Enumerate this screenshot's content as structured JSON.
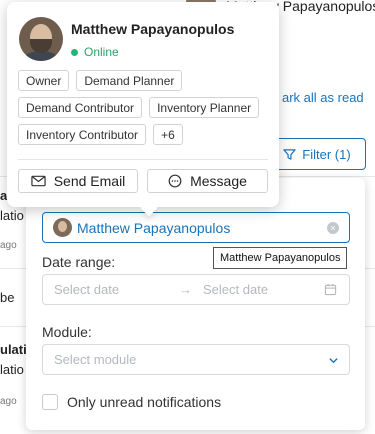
{
  "background": {
    "header_user_name": "Matthew Papayanopulos",
    "mark_all_read": "ark all as read",
    "filter_button": "Filter (1)",
    "rows": [
      {
        "a": "al",
        "b": "latio",
        "c": "ago"
      },
      {
        "a": "be"
      },
      {
        "a": "ulatio",
        "b": "latio",
        "c": "ago"
      }
    ],
    "row_time_suffix": "ago",
    "partial_texts": [
      "al",
      "latio",
      "ago",
      "be",
      "ulatio",
      "latio",
      "ago"
    ]
  },
  "profile_card": {
    "name": "Matthew Papayanopulos",
    "status": "Online",
    "status_color": "#22b573",
    "roles": [
      "Owner",
      "Demand Planner",
      "Demand Contributor",
      "Inventory Planner",
      "Inventory Contributor",
      "+6"
    ],
    "send_email_label": "Send Email",
    "message_label": "Message",
    "icons": {
      "send_email": "envelope-icon",
      "message": "chat-bubble-icon"
    }
  },
  "filter_panel": {
    "selected_user": "Matthew Papayanopulos",
    "tooltip": "Matthew Papayanopulos",
    "date_range_label": "Date range:",
    "date_start_placeholder": "Select date",
    "date_end_placeholder": "Select date",
    "module_label": "Module:",
    "module_placeholder": "Select module",
    "unread_only_label": "Only unread notifications",
    "unread_only_checked": false
  },
  "colors": {
    "accent": "#1a73b8",
    "online": "#22b573"
  }
}
